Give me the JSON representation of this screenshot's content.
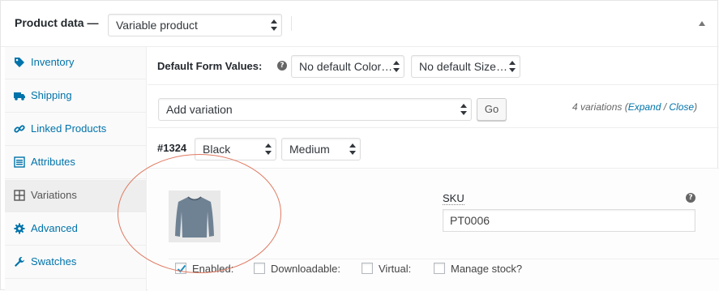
{
  "header": {
    "title": "Product data —",
    "product_type": "Variable product"
  },
  "sidebar": {
    "items": [
      {
        "label": "Inventory",
        "icon": "tag-icon"
      },
      {
        "label": "Shipping",
        "icon": "truck-icon"
      },
      {
        "label": "Linked Products",
        "icon": "link-icon"
      },
      {
        "label": "Attributes",
        "icon": "list-icon"
      },
      {
        "label": "Variations",
        "icon": "grid-icon",
        "active": true
      },
      {
        "label": "Advanced",
        "icon": "gear-icon"
      },
      {
        "label": "Swatches",
        "icon": "wrench-icon"
      }
    ]
  },
  "toolbar": {
    "default_form_values_label": "Default Form Values:",
    "help": "?",
    "color_default": "No default Color…",
    "size_default": "No default Size…"
  },
  "variation_actions": {
    "select_value": "Add variation",
    "go_label": "Go",
    "count_text": "4 variations (",
    "expand_label": "Expand",
    "separator": " / ",
    "close_label": "Close",
    "count_suffix": ")"
  },
  "variation": {
    "id": "#1324",
    "color": "Black",
    "size": "Medium",
    "sku_label": "SKU",
    "sku_help": "?",
    "sku_value": "PT0006",
    "options": [
      {
        "label": "Enabled:",
        "checked": true
      },
      {
        "label": "Downloadable:",
        "checked": false
      },
      {
        "label": "Virtual:",
        "checked": false
      },
      {
        "label": "Manage stock?",
        "checked": false
      }
    ]
  },
  "colors": {
    "link": "#0073aa",
    "annotation": "#e07a62"
  }
}
